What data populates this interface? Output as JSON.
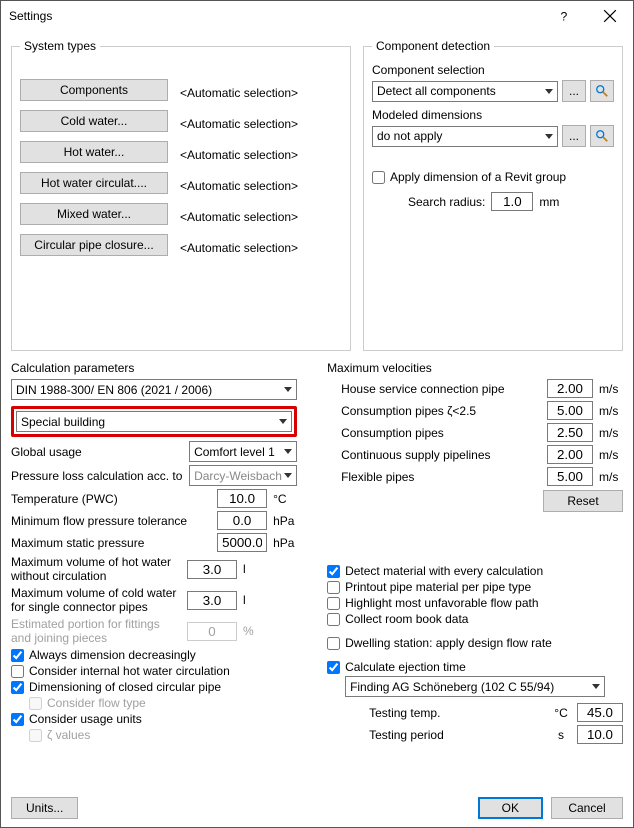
{
  "window": {
    "title": "Settings"
  },
  "system_types": {
    "legend": "System types",
    "rows": [
      {
        "btn": "Components",
        "value": "<Automatic selection>"
      },
      {
        "btn": "Cold water...",
        "value": "<Automatic selection>"
      },
      {
        "btn": "Hot water...",
        "value": "<Automatic selection>"
      },
      {
        "btn": "Hot water circulat....",
        "value": "<Automatic selection>"
      },
      {
        "btn": "Mixed water...",
        "value": "<Automatic selection>"
      },
      {
        "btn": "Circular pipe closure...",
        "value": "<Automatic selection>"
      }
    ]
  },
  "component_detection": {
    "legend": "Component detection",
    "component_selection_label": "Component selection",
    "component_selection_value": "Detect all components",
    "modeled_dims_label": "Modeled dimensions",
    "modeled_dims_value": "do not apply",
    "apply_group_label": "Apply dimension of a Revit group",
    "search_radius_label": "Search radius:",
    "search_radius_value": "1.0",
    "search_radius_unit": "mm"
  },
  "calc_params": {
    "title": "Calculation parameters",
    "standard": "DIN 1988-300/ EN 806 (2021 / 2006)",
    "building_type": "Special building",
    "global_usage_label": "Global usage",
    "global_usage_value": "Comfort level 1",
    "ploss_label": "Pressure loss calculation acc. to",
    "ploss_value": "Darcy-Weisbach",
    "temp_label": "Temperature (PWC)",
    "temp_value": "10.0",
    "temp_unit": "°C",
    "minflow_label": "Minimum flow pressure tolerance",
    "minflow_value": "0.0",
    "minflow_unit": "hPa",
    "maxstatic_label": "Maximum static pressure",
    "maxstatic_value": "5000.0",
    "maxstatic_unit": "hPa",
    "maxhot_label": "Maximum volume of hot water without circulation",
    "maxhot_value": "3.0",
    "maxhot_unit": "l",
    "maxcold_label": "Maximum volume of cold water for single connector pipes",
    "maxcold_value": "3.0",
    "maxcold_unit": "l",
    "est_label": "Estimated portion for fittings and joining pieces",
    "est_value": "0",
    "est_unit": "%",
    "chk_always": "Always dimension decreasingly",
    "chk_internal": "Consider internal hot water circulation",
    "chk_dimclosed": "Dimensioning of closed circular pipe",
    "chk_flowtype": "Consider flow type",
    "chk_usage": "Consider usage units",
    "chk_zeta": "ζ values",
    "units_btn": "Units..."
  },
  "max_vel": {
    "title": "Maximum velocities",
    "rows": [
      {
        "label": "House service connection pipe",
        "value": "2.00",
        "unit": "m/s"
      },
      {
        "label": "Consumption pipes ζ<2.5",
        "value": "5.00",
        "unit": "m/s"
      },
      {
        "label": "Consumption pipes",
        "value": "2.50",
        "unit": "m/s"
      },
      {
        "label": "Continuous supply pipelines",
        "value": "2.00",
        "unit": "m/s"
      },
      {
        "label": "Flexible pipes",
        "value": "5.00",
        "unit": "m/s"
      }
    ],
    "reset": "Reset"
  },
  "right_opts": {
    "detect_material": "Detect material with every calculation",
    "printout": "Printout pipe material per pipe type",
    "highlight": "Highlight most unfavorable flow path",
    "collect": "Collect room book data",
    "dwelling": "Dwelling station: apply design flow rate",
    "ejection": "Calculate ejection time",
    "ejection_value": "Finding AG Schöneberg (102 C 55/94)",
    "test_temp_label": "Testing temp.",
    "test_temp_unit": "°C",
    "test_temp_value": "45.0",
    "test_period_label": "Testing period",
    "test_period_unit": "s",
    "test_period_value": "10.0"
  },
  "buttons": {
    "ok": "OK",
    "cancel": "Cancel"
  }
}
